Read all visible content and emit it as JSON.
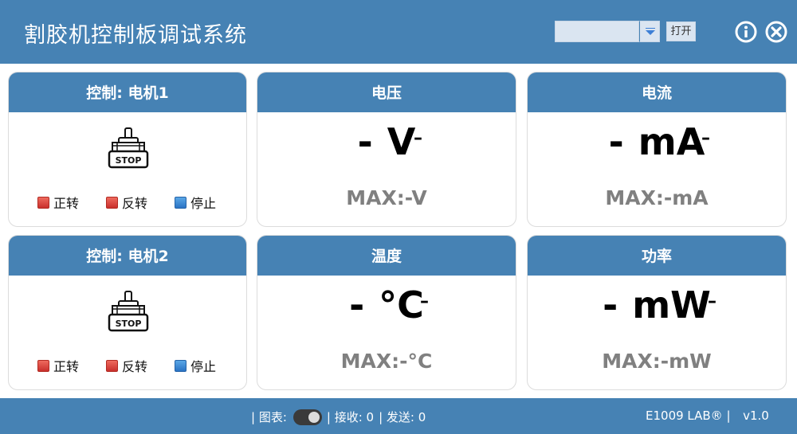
{
  "app": {
    "title": "割胶机控制板调试系统",
    "open_button": "打开",
    "port_selected": ""
  },
  "motors": [
    {
      "title": "控制: 电机1",
      "status_icon": "stop-motor-icon",
      "status_label": "STOP",
      "controls": [
        {
          "label": "正转",
          "color": "#d9403a"
        },
        {
          "label": "反转",
          "color": "#d9403a"
        },
        {
          "label": "停止",
          "color": "#2f7fd0"
        }
      ]
    },
    {
      "title": "控制: 电机2",
      "status_icon": "stop-motor-icon",
      "status_label": "STOP",
      "controls": [
        {
          "label": "正转",
          "color": "#d9403a"
        },
        {
          "label": "反转",
          "color": "#d9403a"
        },
        {
          "label": "停止",
          "color": "#2f7fd0"
        }
      ]
    }
  ],
  "meters": {
    "voltage": {
      "title": "电压",
      "value": "-",
      "unit": "V",
      "aux": "–",
      "max": "MAX:-V"
    },
    "current": {
      "title": "电流",
      "value": "-",
      "unit": "mA",
      "aux": "–",
      "max": "MAX:-mA"
    },
    "temperature": {
      "title": "温度",
      "value": "-",
      "unit": "°C",
      "aux": "–",
      "max": "MAX:-°C"
    },
    "power": {
      "title": "功率",
      "value": "-",
      "unit": "mW",
      "aux": "–",
      "max": "MAX:-mW"
    }
  },
  "status": {
    "chart_label": "| 图表:",
    "chart_toggle_on": true,
    "received": "| 接收: 0",
    "sent": "| 发送: 0",
    "brand": "E1009 LAB® |",
    "version": "v1.0"
  },
  "colors": {
    "accent": "#4682b4",
    "forward": "#d9403a",
    "stop": "#2f7fd0",
    "max_text": "#808080"
  }
}
